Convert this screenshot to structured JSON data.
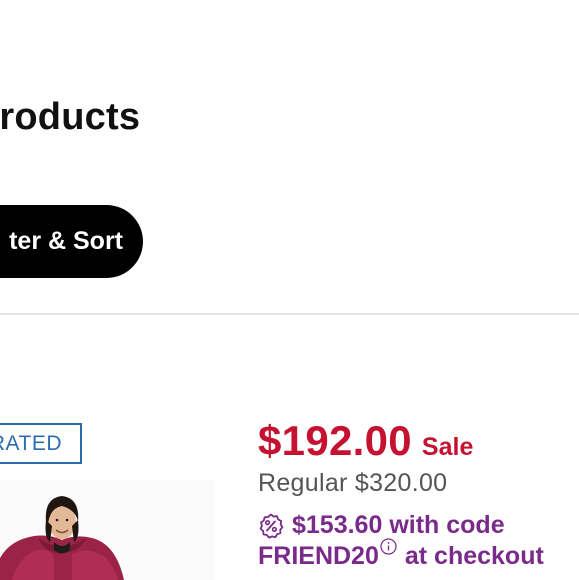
{
  "results": {
    "title_fragment": "products"
  },
  "filter": {
    "label_fragment": "ter & Sort"
  },
  "product": {
    "badge_fragment": "RATED",
    "sale_price": "$192.00",
    "sale_label": "Sale",
    "regular_price": "Regular $320.00",
    "promo_price": "$153.60",
    "promo_with_code": "with code",
    "promo_code": "FRIEND20",
    "promo_at_checkout": "at checkout"
  },
  "colors": {
    "sale_red": "#c41230",
    "promo_purple": "#7a2a8a",
    "badge_blue": "#2b6cb0",
    "button_black": "#000000"
  },
  "icons": {
    "promo": "percent-badge-icon",
    "info": "info-icon"
  }
}
